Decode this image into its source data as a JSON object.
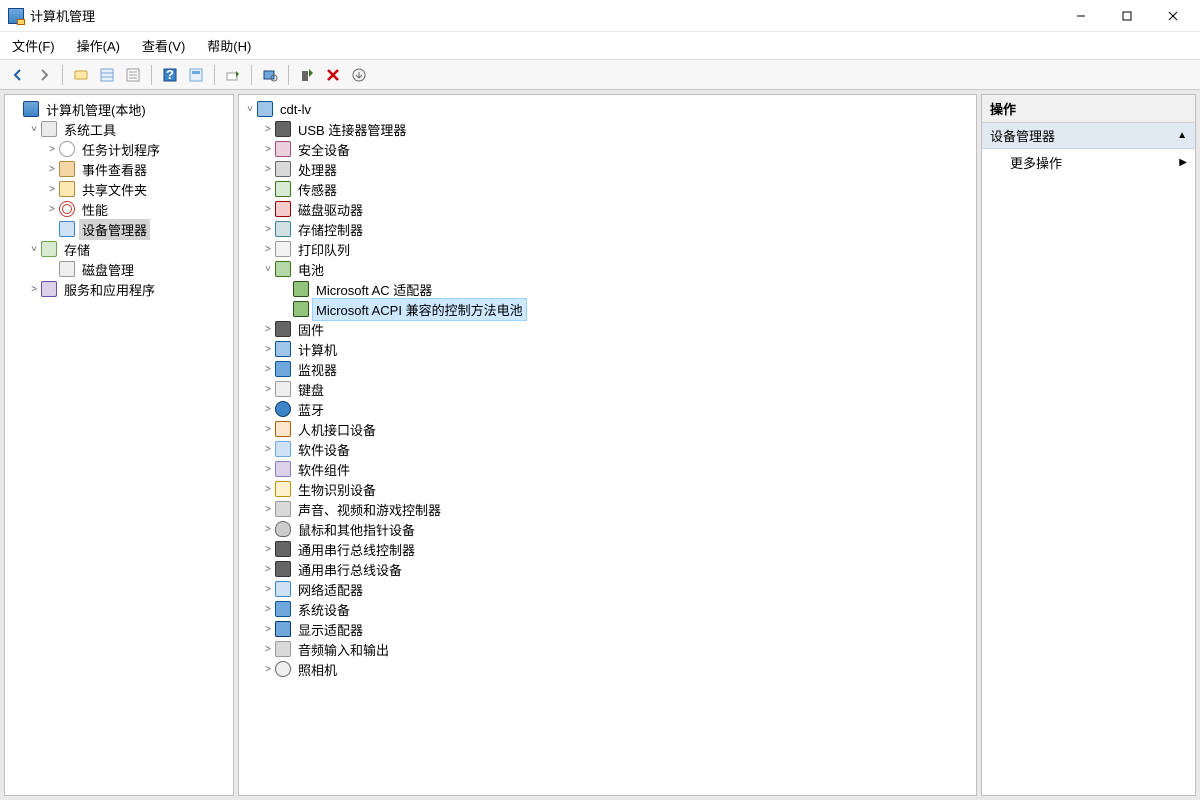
{
  "window": {
    "title": "计算机管理"
  },
  "menus": {
    "file": "文件(F)",
    "action": "操作(A)",
    "view": "查看(V)",
    "help": "帮助(H)"
  },
  "leftTree": {
    "root": "计算机管理(本地)",
    "sysTools": "系统工具",
    "taskScheduler": "任务计划程序",
    "eventViewer": "事件查看器",
    "sharedFolders": "共享文件夹",
    "performance": "性能",
    "deviceManager": "设备管理器",
    "storage": "存储",
    "diskMgmt": "磁盘管理",
    "servicesApps": "服务和应用程序"
  },
  "center": {
    "host": "cdt-lv",
    "usbConnector": "USB 连接器管理器",
    "securityDevices": "安全设备",
    "processor": "处理器",
    "sensor": "传感器",
    "diskDrives": "磁盘驱动器",
    "storageControllers": "存储控制器",
    "printQueues": "打印队列",
    "battery": "电池",
    "msAcAdapter": "Microsoft AC 适配器",
    "msAcpiBattery": "Microsoft ACPI 兼容的控制方法电池",
    "firmware": "固件",
    "computer": "计算机",
    "monitor": "监视器",
    "keyboard": "键盘",
    "bluetooth": "蓝牙",
    "hid": "人机接口设备",
    "softwareDevices": "软件设备",
    "softwareComponents": "软件组件",
    "biometric": "生物识别设备",
    "audioVideoGame": "声音、视频和游戏控制器",
    "mouse": "鼠标和其他指针设备",
    "usbControllers": "通用串行总线控制器",
    "usbDevices": "通用串行总线设备",
    "networkAdapters": "网络适配器",
    "systemDevices": "系统设备",
    "displayAdapters": "显示适配器",
    "audioIO": "音频输入和输出",
    "camera": "照相机"
  },
  "actionsPane": {
    "header": "操作",
    "section": "设备管理器",
    "moreActions": "更多操作"
  }
}
